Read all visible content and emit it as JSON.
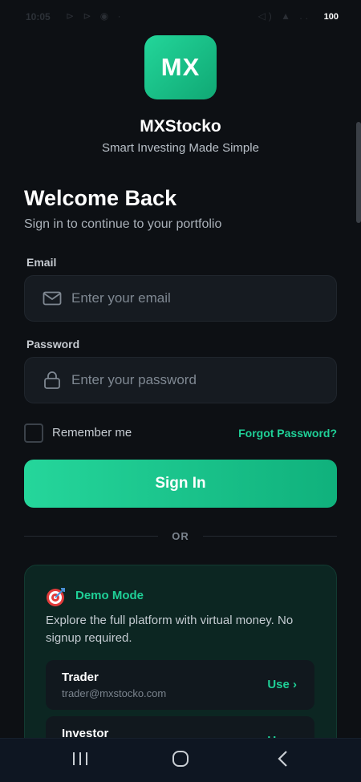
{
  "status_bar": {
    "time": "10:05",
    "left_icons": "⊳ ⊳ ◉ ·",
    "right_icons": "◁) ▲ ..",
    "battery": "100"
  },
  "brand": {
    "logo_text": "MX",
    "name": "MXStocko",
    "tagline": "Smart Investing Made Simple",
    "accent_color": "#1fd097"
  },
  "welcome": {
    "title": "Welcome Back",
    "subtitle": "Sign in to continue to your portfolio"
  },
  "form": {
    "email_label": "Email",
    "email_placeholder": "Enter your email",
    "email_value": "",
    "email_icon": "mail-icon",
    "password_label": "Password",
    "password_placeholder": "Enter your password",
    "password_value": "",
    "password_icon": "lock-icon",
    "remember_label": "Remember me",
    "remember_checked": false,
    "forgot_label": "Forgot Password?",
    "submit_label": "Sign In"
  },
  "divider": {
    "text": "OR"
  },
  "demo": {
    "icon": "target-icon",
    "title": "Demo Mode",
    "description": "Explore the full platform with virtual money. No signup required.",
    "accounts": [
      {
        "name": "Trader",
        "email": "trader@mxstocko.com",
        "action": "Use ›"
      },
      {
        "name": "Investor",
        "email": "",
        "action": "Use ›"
      }
    ]
  },
  "nav_bar": {
    "buttons": [
      "recent-apps-icon",
      "home-icon",
      "back-icon"
    ]
  }
}
